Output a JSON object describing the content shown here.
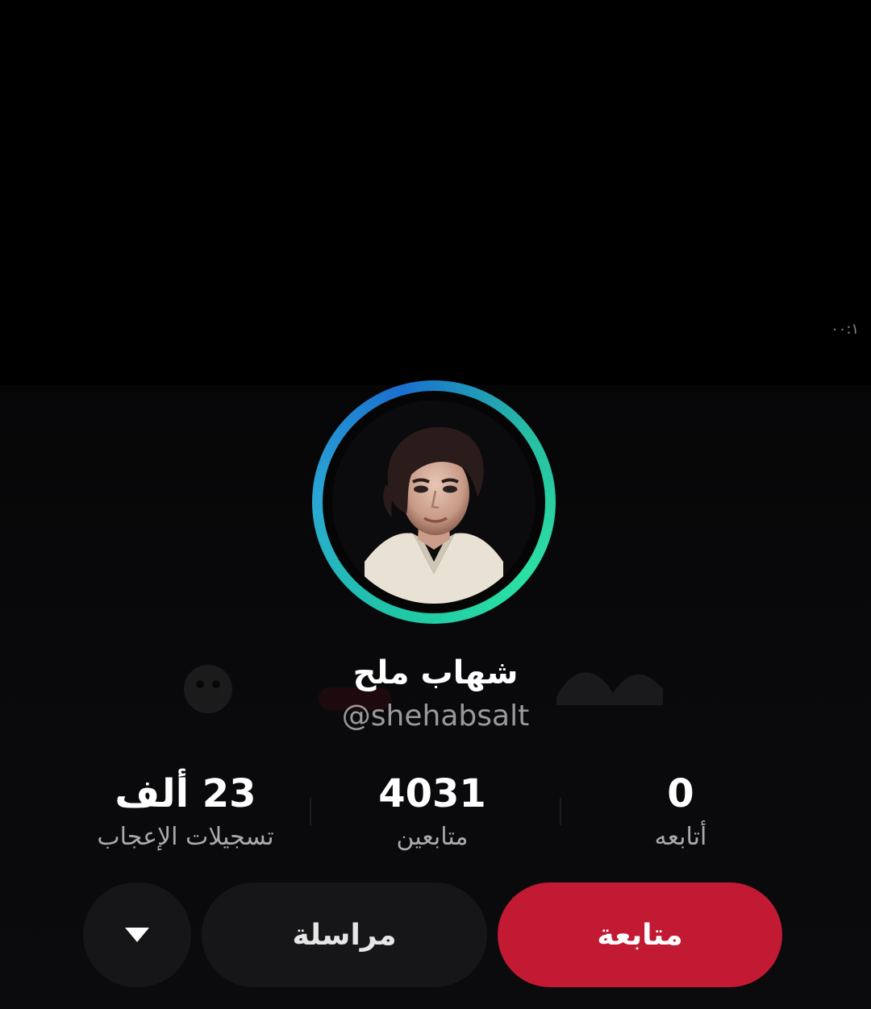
{
  "status": {
    "time_fragment": "٠٠:١"
  },
  "profile": {
    "display_name": "شهاب ملح",
    "username": "@shehabsalt",
    "ring_colors": [
      "#1fc6a6",
      "#2aa7d4",
      "#2be0a3"
    ]
  },
  "stats": [
    {
      "value": "23 ألف",
      "label": "تسجيلات الإعجاب"
    },
    {
      "value": "4031",
      "label": "متابعين"
    },
    {
      "value": "0",
      "label": "أتابعه"
    }
  ],
  "actions": {
    "follow_label": "متابعة",
    "follow_color": "#c21a33",
    "message_label": "مراسلة",
    "more_icon": "caret-down-icon"
  }
}
